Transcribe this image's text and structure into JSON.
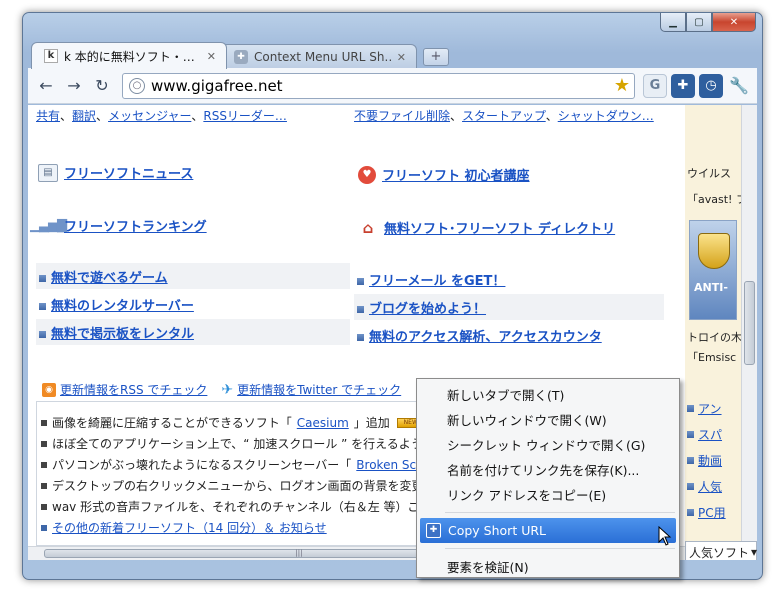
{
  "browser": {
    "tabs": [
      {
        "label": "k 本的に無料ソフト・…",
        "favicon": "k"
      },
      {
        "label": "Context Menu URL Sh…",
        "favicon": "puzzle"
      }
    ],
    "url": "www.gigafree.net"
  },
  "page": {
    "toplinks_left": [
      "共有",
      "翻訳",
      "メッセンジャー",
      "RSSリーダー…"
    ],
    "toplinks_right": [
      "不要ファイル削除",
      "スタートアップ",
      "シャットダウン…"
    ],
    "sections": {
      "news": "フリーソフトニュース",
      "beginner": "フリーソフト 初心者講座",
      "ranking": "フリーソフトランキング",
      "directory": "無料ソフト･フリーソフト ディレクトリ"
    },
    "links_left": [
      "無料で遊べるゲーム",
      "無料のレンタルサーバー",
      "無料で掲示板をレンタル"
    ],
    "links_right": [
      "フリーメール をGET！",
      "ブログを始めよう！",
      "無料のアクセス解析、アクセスカウンタ"
    ],
    "check_rss": "更新情報をRSS でチェック",
    "check_twitter": "更新情報をTwitter でチェック",
    "news": [
      {
        "pre": "画像を綺麗に圧縮することができるソフト「",
        "link": "Caesium",
        "post": "」追加"
      },
      {
        "pre": "ほぼ全てのアプリケーション上で、“ 加速スクロール ” を行えるように",
        "link": "",
        "post": ""
      },
      {
        "pre": "パソコンがぶっ壊れたようになるスクリーンセーバー「",
        "link": "Broken Scree",
        "post": ""
      },
      {
        "pre": "デスクトップの右クリックメニューから、ログオン画面の背景を変更で",
        "link": "",
        "post": ""
      },
      {
        "pre": "wav 形式の音声ファイルを、それぞれのチャンネル（右＆左 等）ご",
        "link": "",
        "post": ""
      }
    ],
    "more_news": "その他の新着フリーソフト（14 回分）＆ お知らせ",
    "side": {
      "text1": "ウイルス",
      "text2": "「avast! フ",
      "ad_text": "ANTI-",
      "text3": "トロイの木",
      "text4": "「Emsisc",
      "list": [
        "アン",
        "スパ",
        "動画",
        "人気",
        "PC用"
      ],
      "popular": "人気ソフト"
    }
  },
  "context_menu": {
    "items": [
      "新しいタブで開く(T)",
      "新しいウィンドウで開く(W)",
      "シークレット ウィンドウで開く(G)",
      "名前を付けてリンク先を保存(K)...",
      "リンク アドレスをコピー(E)"
    ],
    "extension_item": "Copy Short URL",
    "inspect": "要素を検証(N)"
  }
}
